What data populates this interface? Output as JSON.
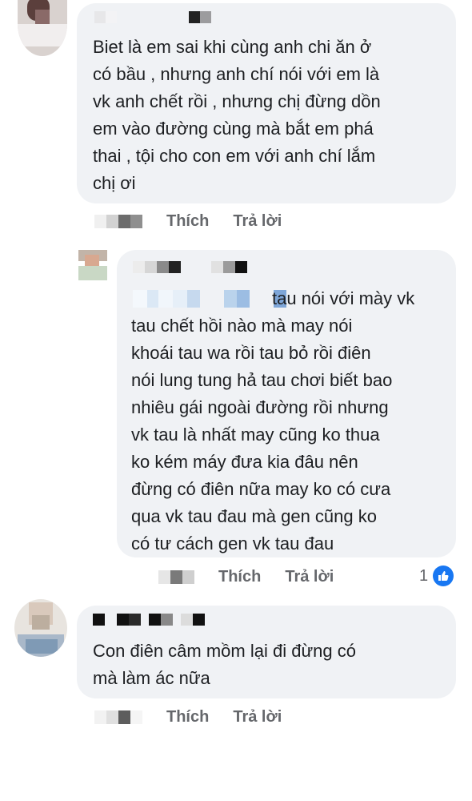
{
  "comments": [
    {
      "text": "Biet là em sai khi cùng anh chi ăn ở\ncó bầu , nhưng anh chí nói với em là\nvk anh chết rồi , nhưng chị đừng dồn\nem vào  đường cùng mà bắt em phá\nthai , tội cho con em với anh chí lắm\nchị ơi",
      "like_label": "Thích",
      "reply_label": "Trả lời"
    },
    {
      "text_first_line": "tau nói với mày vk",
      "text": "tau chết hồi nào mà may nói\nkhoái tau wa rồi tau bỏ rồi điên\nnói lung tung hả tau chơi biết bao\nnhiêu gái ngoài đường rồi nhưng\nvk tau là nhất may cũng ko thua\nko kém máy đưa kia đâu nên\nđừng có điên nữa may ko có cưa\nqua vk tau đau mà gen cũng ko\ncó tư cách gen vk tau đau",
      "like_label": "Thích",
      "reply_label": "Trả lời",
      "reaction_count": "1",
      "reaction_icon": "like-thumb-icon"
    },
    {
      "text": "Con điên câm mồm lại đi đừng có\nmà làm ác nữa",
      "like_label": "Thích",
      "reply_label": "Trả lời"
    }
  ],
  "colors": {
    "bubble": "#f0f2f5",
    "text": "#1c1e21",
    "secondary": "#65676b",
    "like_blue": "#1877f2"
  }
}
